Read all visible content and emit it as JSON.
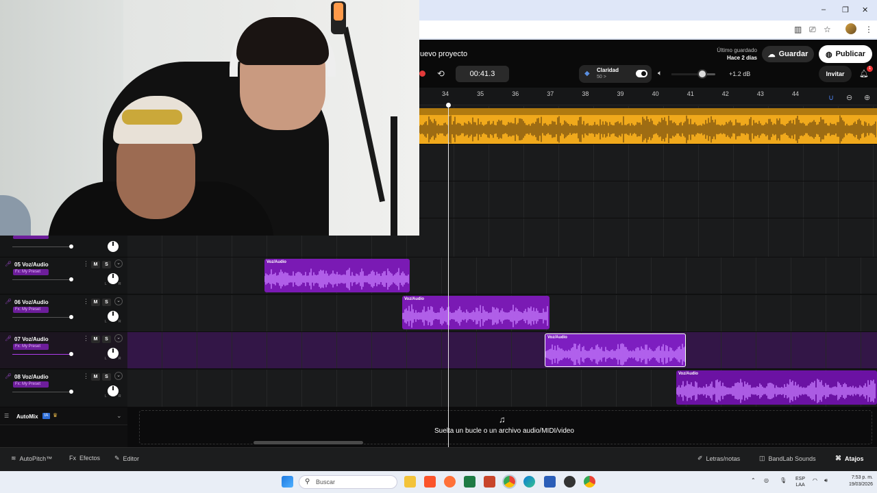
{
  "browser": {
    "window_controls": [
      "–",
      "❐",
      "✕"
    ],
    "toolbar_icons": [
      "reading-list-icon",
      "cast-icon",
      "star-icon",
      "profile-avatar",
      "kebab-menu-icon"
    ]
  },
  "header": {
    "project_title": "uevo proyecto",
    "last_saved_label": "Último guardado",
    "last_saved_time": "Hace 2 días",
    "save_label": "Guardar",
    "publish_label": "Publicar",
    "invite_label": "Invitar",
    "notifications_count": "1"
  },
  "transport": {
    "time": "00:41.3",
    "clarity_label": "Claridad",
    "clarity_value": "50 >",
    "volume_db": "+1.2 dB",
    "volume_level_fraction": 0.7
  },
  "ruler": {
    "bars": [
      "34",
      "35",
      "36",
      "37",
      "38",
      "39",
      "40",
      "41",
      "42",
      "43",
      "44"
    ]
  },
  "tracks": [
    {
      "number": "05",
      "name": "Voz/Audio",
      "fx": "Fx: My Preset",
      "mute": "M",
      "solo": "S",
      "clip_label": "Voz/Audio"
    },
    {
      "number": "06",
      "name": "Voz/Audio",
      "fx": "Fx: My Preset",
      "mute": "M",
      "solo": "S",
      "clip_label": "Voz/Audio"
    },
    {
      "number": "07",
      "name": "Voz/Audio",
      "fx": "Fx: My Preset",
      "mute": "M",
      "solo": "S",
      "clip_label": "Voz/Audio"
    },
    {
      "number": "08",
      "name": "Voz/Audio",
      "fx": "Fx: My Preset",
      "mute": "M",
      "solo": "S",
      "clip_label": "Voz/Audio"
    }
  ],
  "pan_labels": {
    "left": "L",
    "right": "R"
  },
  "automix": {
    "label": "AutoMix",
    "badge": "IA"
  },
  "drop_zone": {
    "text": "Suelta un bucle o un archivo audio/MIDI/video"
  },
  "bottom_bar": {
    "autopitch": "AutoPitch™",
    "effects": "Efectos",
    "editor": "Editor",
    "lyrics": "Letras/notas",
    "sounds": "BandLab Sounds",
    "shortcuts": "Atajos"
  },
  "taskbar": {
    "search_placeholder": "Buscar",
    "language": "ESP",
    "layout": "LAA",
    "time": "7:53 p. m.",
    "date": "19/03/2026"
  },
  "colors": {
    "accent_purple": "#7a1ab4",
    "loop_yellow": "#f0a91c",
    "record_red": "#e23a3a"
  }
}
